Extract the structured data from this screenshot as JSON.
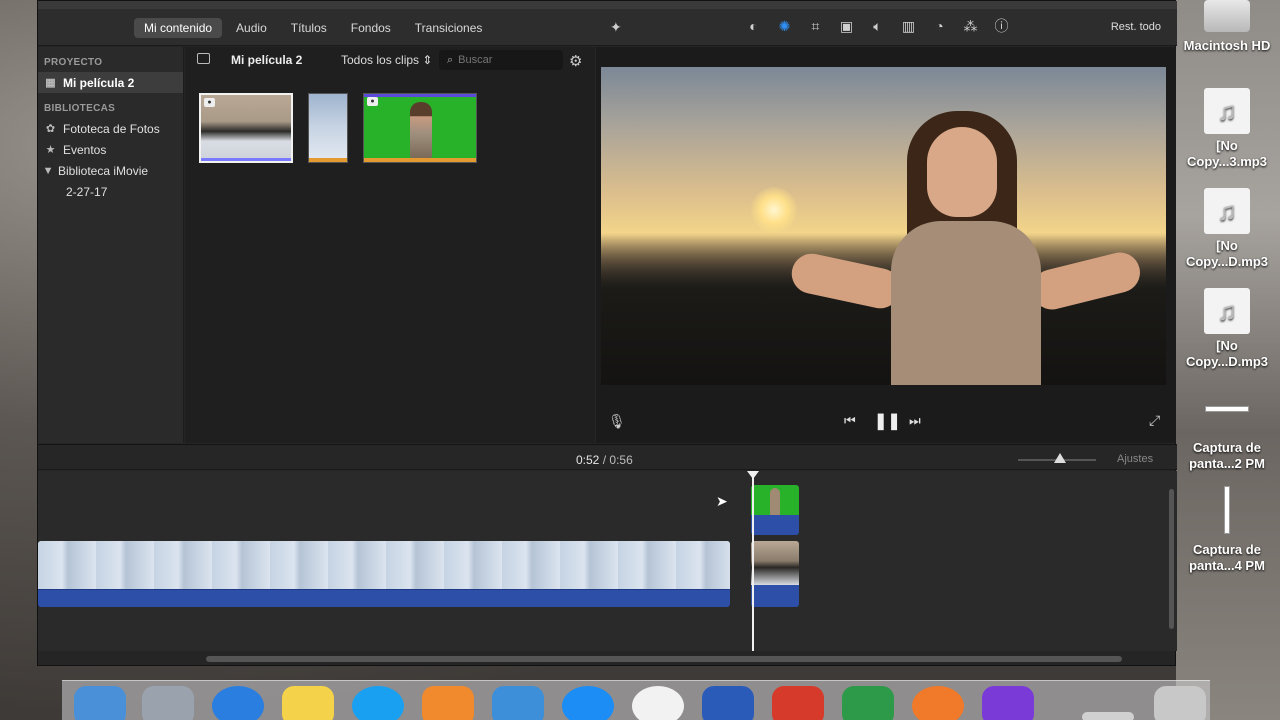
{
  "toolbar": {
    "nav": [
      "Mi contenido",
      "Audio",
      "Títulos",
      "Fondos",
      "Transiciones"
    ],
    "active_nav": "Mi contenido",
    "reset_label": "Rest. todo",
    "tools": [
      "color-balance-icon",
      "color-correction-icon",
      "crop-icon",
      "stabilization-icon",
      "volume-icon",
      "equalizer-icon",
      "speed-icon",
      "filter-icon",
      "info-icon"
    ]
  },
  "sidebar": {
    "project_header": "PROYECTO",
    "project_item": "Mi película 2",
    "libraries_header": "BIBLIOTECAS",
    "items": [
      "Fototeca de Fotos",
      "Eventos",
      "Biblioteca iMovie",
      "2-27-17"
    ]
  },
  "browser": {
    "title": "Mi película 2",
    "clips_filter": "Todos los clips",
    "search_placeholder": "Buscar"
  },
  "timeline": {
    "current_time": "0:52",
    "separator": "/",
    "total_time": "0:56",
    "settings_label": "Ajustes"
  },
  "desktop": {
    "items": [
      "Macintosh HD",
      "[No Copy...3.mp3",
      "[No Copy...D.mp3",
      "[No Copy...D.mp3",
      "Captura de panta...2 PM",
      "Captura de panta...4 PM"
    ]
  },
  "colors": {
    "accent": "#2f8ff2",
    "audio_track": "#2e4fa8",
    "green_screen": "#27b22a"
  }
}
